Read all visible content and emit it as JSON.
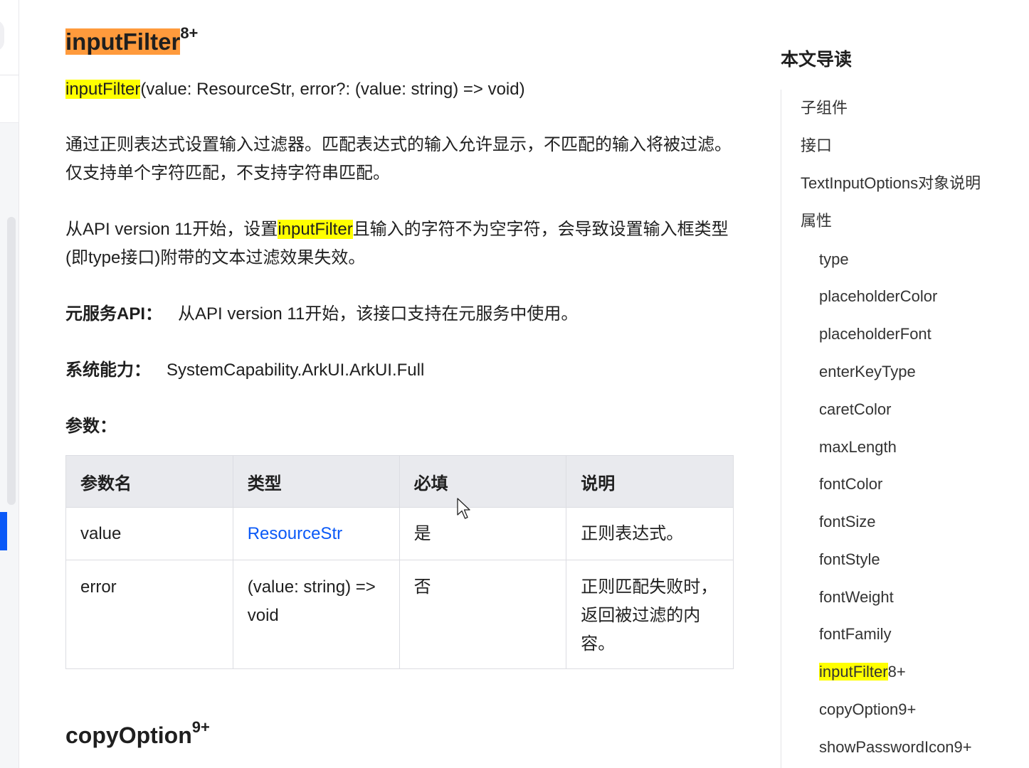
{
  "section_title": {
    "label": "inputFilter",
    "sup": "8+"
  },
  "signature": {
    "name": "inputFilter",
    "rest": "(value: ResourceStr, error?: (value: string) => void)"
  },
  "description": "通过正则表达式设置输入过滤器。匹配表达式的输入允许显示，不匹配的输入将被过滤。仅支持单个字符匹配，不支持字符串匹配。",
  "note": {
    "before": "从API version 11开始，设置",
    "highlight": "inputFilter",
    "after": "且输入的字符不为空字符，会导致设置输入框类型(即type接口)附带的文本过滤效果失效。"
  },
  "meta_service": {
    "label": "元服务API：",
    "value": "从API version 11开始，该接口支持在元服务中使用。"
  },
  "system_capability": {
    "label": "系统能力：",
    "value": "SystemCapability.ArkUI.ArkUI.Full"
  },
  "params_heading": "参数：",
  "params_table": {
    "headers": [
      "参数名",
      "类型",
      "必填",
      "说明"
    ],
    "rows": [
      {
        "name": "value",
        "type": "ResourceStr",
        "required": "是",
        "desc": "正则表达式。"
      },
      {
        "name": "error",
        "type": "(value: string) => void",
        "required": "否",
        "desc": "正则匹配失败时，返回被过滤的内容。"
      }
    ]
  },
  "next_section": {
    "label": "copyOption",
    "sup": "9+"
  },
  "toc": {
    "title": "本文导读",
    "highlight_color": "#ffff00",
    "items": [
      {
        "label": "子组件",
        "level": 1
      },
      {
        "label": "接口",
        "level": 1
      },
      {
        "label": "TextInputOptions对象说明",
        "level": 1
      },
      {
        "label": "属性",
        "level": 1
      },
      {
        "label": "type",
        "level": 2
      },
      {
        "label": "placeholderColor",
        "level": 2
      },
      {
        "label": "placeholderFont",
        "level": 2
      },
      {
        "label": "enterKeyType",
        "level": 2
      },
      {
        "label": "caretColor",
        "level": 2
      },
      {
        "label": "maxLength",
        "level": 2
      },
      {
        "label": "fontColor",
        "level": 2
      },
      {
        "label": "fontSize",
        "level": 2
      },
      {
        "label": "fontStyle",
        "level": 2
      },
      {
        "label": "fontWeight",
        "level": 2
      },
      {
        "label": "fontFamily",
        "level": 2
      },
      {
        "label": "inputFilter",
        "suffix": "8+",
        "level": 2,
        "highlighted": true
      },
      {
        "label": "copyOption9+",
        "level": 2
      },
      {
        "label": "showPasswordIcon9+",
        "level": 2
      }
    ]
  },
  "colors": {
    "link": "#0a59f7",
    "title_highlight": "#ff9a3c",
    "search_highlight": "#ffff00"
  }
}
